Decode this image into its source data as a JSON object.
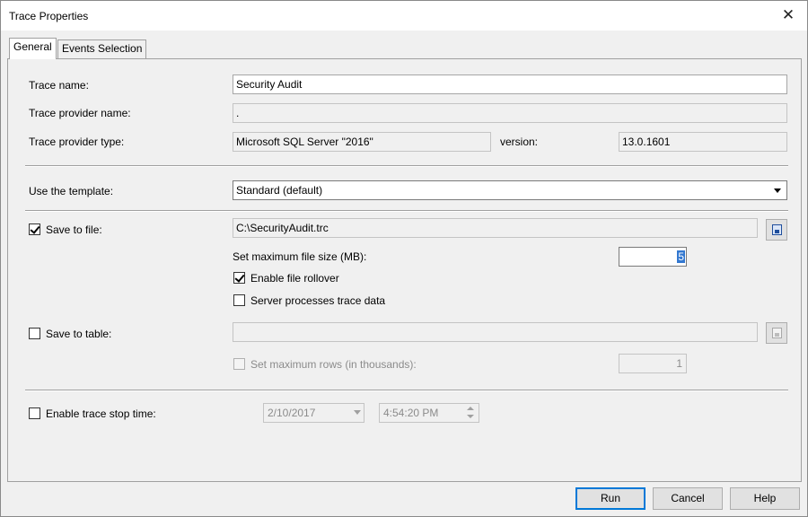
{
  "window": {
    "title": "Trace Properties"
  },
  "tabs": [
    {
      "label": "General",
      "active": true
    },
    {
      "label": "Events Selection",
      "active": false
    }
  ],
  "general": {
    "trace_name": {
      "label": "Trace name:",
      "value": "Security Audit"
    },
    "provider_name": {
      "label": "Trace provider name:",
      "value": "."
    },
    "provider_type": {
      "label": "Trace provider type:",
      "value": "Microsoft SQL Server \"2016\""
    },
    "version": {
      "label": "version:",
      "value": "13.0.1601"
    },
    "template": {
      "label": "Use the template:",
      "value": "Standard (default)"
    },
    "save_to_file": {
      "label": "Save to file:",
      "checked": true,
      "path": "C:\\SecurityAudit.trc",
      "max_size_label": "Set maximum file size (MB):",
      "max_size_value": "5",
      "rollover_label": "Enable file rollover",
      "rollover_checked": true,
      "server_processes_label": "Server processes trace data",
      "server_processes_checked": false
    },
    "save_to_table": {
      "label": "Save to table:",
      "checked": false,
      "value": "",
      "max_rows_label": "Set maximum rows (in thousands):",
      "max_rows_checked": false,
      "max_rows_value": "1"
    },
    "stop_time": {
      "label": "Enable trace stop time:",
      "checked": false,
      "date": "2/10/2017",
      "time": "4:54:20 PM"
    }
  },
  "buttons": {
    "run": "Run",
    "cancel": "Cancel",
    "help": "Help"
  },
  "colors": {
    "accent": "#0078d7",
    "selection": "#3378d0",
    "background": "#f0f0f0"
  }
}
